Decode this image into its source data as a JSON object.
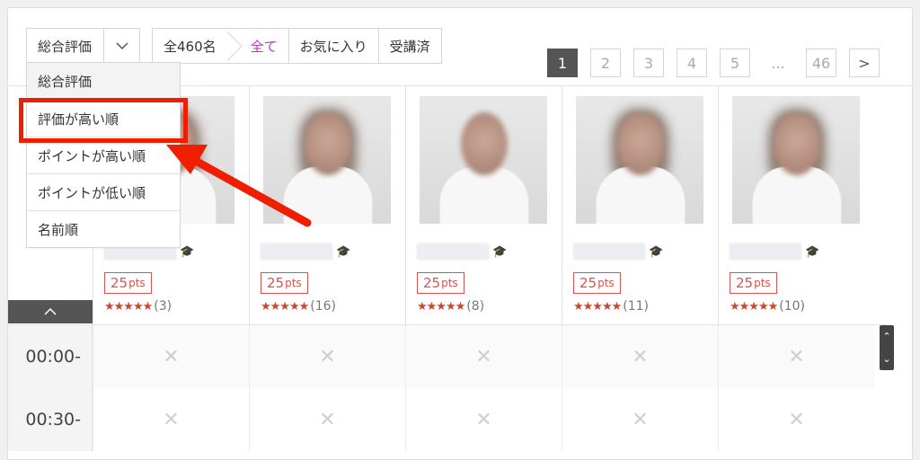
{
  "sort": {
    "selected": "総合評価"
  },
  "filters": [
    {
      "label": "全460名"
    },
    {
      "label": "全て"
    },
    {
      "label": "お気に入り"
    },
    {
      "label": "受講済"
    }
  ],
  "pagination": [
    "1",
    "2",
    "3",
    "4",
    "5",
    "...",
    "46",
    ">"
  ],
  "dropdown_options": [
    "総合評価",
    "評価が高い順",
    "ポイントが高い順",
    "ポイントが低い順",
    "名前順"
  ],
  "tutors": [
    {
      "points": "25",
      "unit": "pts",
      "stars": "★★★★★",
      "reviews": "(3)"
    },
    {
      "points": "25",
      "unit": "pts",
      "stars": "★★★★★",
      "reviews": "(16)"
    },
    {
      "points": "25",
      "unit": "pts",
      "stars": "★★★★★",
      "reviews": "(8)"
    },
    {
      "points": "25",
      "unit": "pts",
      "stars": "★★★★★",
      "reviews": "(11)"
    },
    {
      "points": "25",
      "unit": "pts",
      "stars": "★★★★★",
      "reviews": "(10)"
    }
  ],
  "time_slots": [
    "00:00-",
    "00:30-"
  ],
  "cell_mark": "✕",
  "icons": {
    "chevron": "chevron-down-icon",
    "cap": "graduation-cap-icon",
    "collapse": "chevron-up-icon"
  },
  "colors": {
    "accent": "#b23ab2",
    "points": "#d9534f",
    "stars": "#d0452d",
    "highlight": "#f01e00"
  }
}
